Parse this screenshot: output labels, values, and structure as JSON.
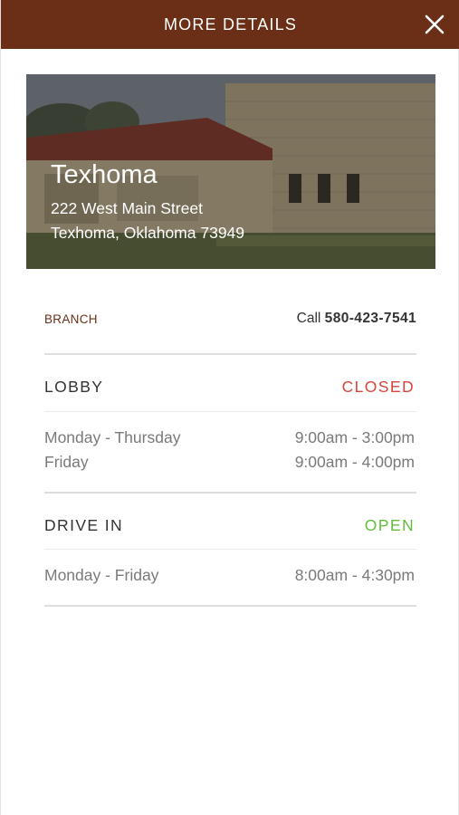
{
  "header": {
    "title": "MORE DETAILS",
    "close_icon": "close-icon"
  },
  "branch": {
    "name": "Texhoma",
    "address_line1": "222 West Main Street",
    "address_line2": "Texhoma, Oklahoma 73949",
    "type_label": "BRANCH",
    "call_prefix": "Call",
    "phone": "580-423-7541"
  },
  "lobby": {
    "title": "LOBBY",
    "status": "CLOSED",
    "hours": [
      {
        "days": "Monday - Thursday",
        "time": "9:00am - 3:00pm"
      },
      {
        "days": "Friday",
        "time": "9:00am - 4:00pm"
      }
    ]
  },
  "drive_in": {
    "title": "DRIVE IN",
    "status": "OPEN",
    "hours": [
      {
        "days": "Monday - Friday",
        "time": "8:00am - 4:30pm"
      }
    ]
  },
  "colors": {
    "header_bg": "#6a2f16",
    "closed": "#d9443b",
    "open": "#62bd3a"
  }
}
